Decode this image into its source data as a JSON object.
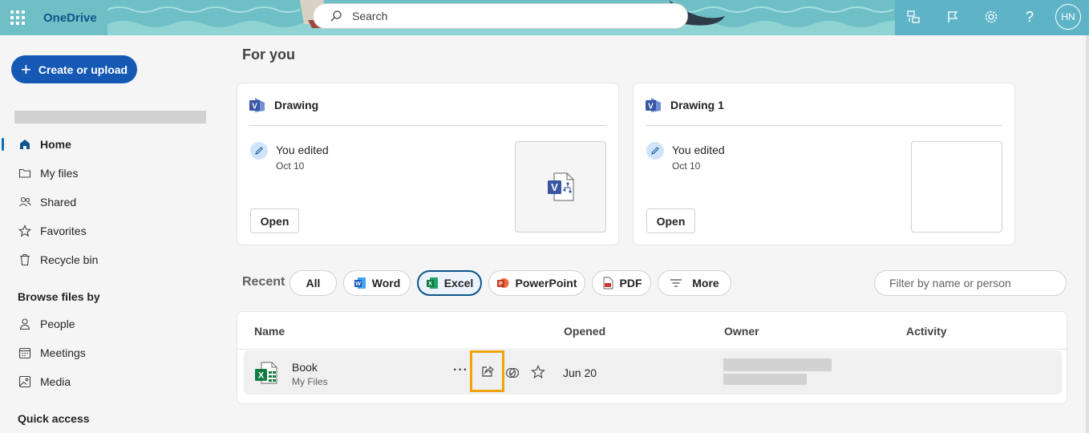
{
  "header": {
    "app_name": "OneDrive",
    "search_placeholder": "Search",
    "avatar_initials": "HN"
  },
  "sidebar": {
    "create_label": "Create or upload",
    "nav_items": [
      {
        "label": "Home",
        "icon": "home-icon",
        "active": true
      },
      {
        "label": "My files",
        "icon": "folder-icon"
      },
      {
        "label": "Shared",
        "icon": "people-icon"
      },
      {
        "label": "Favorites",
        "icon": "star-icon"
      },
      {
        "label": "Recycle bin",
        "icon": "trash-icon"
      }
    ],
    "browse_title": "Browse files by",
    "browse_items": [
      {
        "label": "People",
        "icon": "person-icon"
      },
      {
        "label": "Meetings",
        "icon": "calendar-icon"
      },
      {
        "label": "Media",
        "icon": "image-icon"
      }
    ],
    "quick_access_title": "Quick access"
  },
  "main": {
    "title": "For you",
    "cards": [
      {
        "title": "Drawing",
        "activity": "You edited",
        "date": "Oct 10",
        "open_label": "Open"
      },
      {
        "title": "Drawing 1",
        "activity": "You edited",
        "date": "Oct 10",
        "open_label": "Open"
      }
    ],
    "recent": {
      "label": "Recent",
      "filters": [
        {
          "label": "All"
        },
        {
          "label": "Word",
          "icon": "word-icon"
        },
        {
          "label": "Excel",
          "icon": "excel-icon",
          "selected": true
        },
        {
          "label": "PowerPoint",
          "icon": "powerpoint-icon"
        },
        {
          "label": "PDF",
          "icon": "pdf-icon"
        },
        {
          "label": "More",
          "icon": "filter-lines-icon"
        }
      ],
      "filter_placeholder": "Filter by name or person"
    },
    "table": {
      "columns": [
        "Name",
        "Opened",
        "Owner",
        "Activity"
      ],
      "rows": [
        {
          "name": "Book",
          "location": "My Files",
          "opened": "Jun 20",
          "more": "···"
        }
      ]
    }
  },
  "colors": {
    "accent": "#0f548c",
    "create_button": "#1559b5",
    "highlight_box": "#f0a30a",
    "excel_green": "#107c41",
    "visio_blue": "#3955a3"
  }
}
